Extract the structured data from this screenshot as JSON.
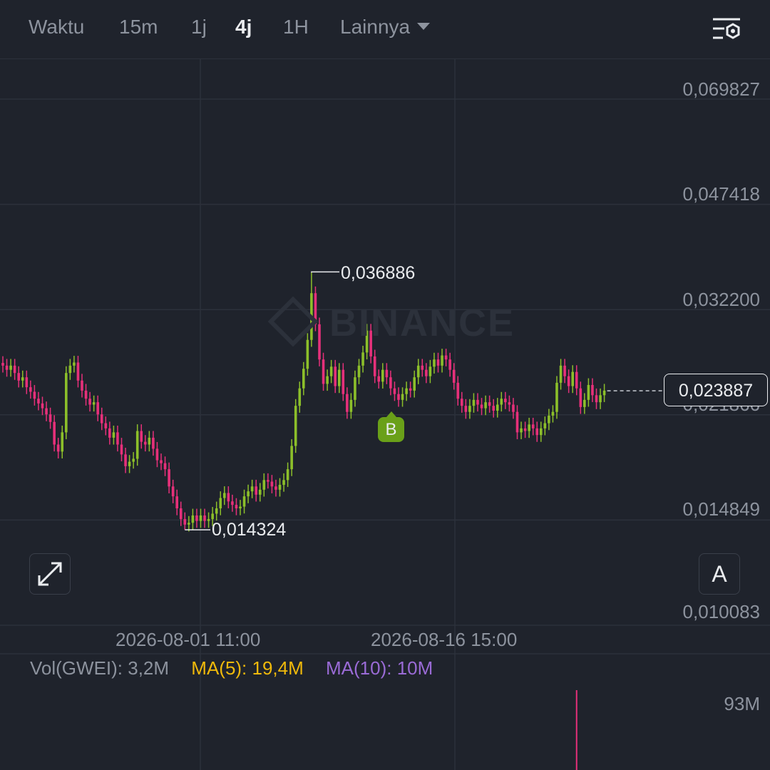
{
  "toolbar": {
    "time_label": "Waktu",
    "intervals": [
      "15m",
      "1j",
      "4j",
      "1H"
    ],
    "active_interval": "4j",
    "more_label": "Lainnya"
  },
  "colors": {
    "background": "#1f232c",
    "up": "#8cbf2a",
    "down": "#e6307a",
    "ma5": "#f0b90b",
    "ma10": "#9a6bd6",
    "grid": "#2c313b"
  },
  "watermark": "BINANCE",
  "last_price": "0,023887",
  "signal_marker": "B",
  "auto_button": "A",
  "chart_data": {
    "type": "candlestick",
    "price_axis_labels": [
      "0,069827",
      "0,047418",
      "0,032200",
      "0,021866",
      "0,014849",
      "0,010083"
    ],
    "price_axis_values": [
      0.069827,
      0.047418,
      0.0322,
      0.021866,
      0.014849,
      0.010083
    ],
    "y_scale": "log",
    "x_tick_labels": [
      "2026-08-01 11:00",
      "2026-08-16 15:00"
    ],
    "high": {
      "label": "0,036886",
      "value": 0.036886
    },
    "low": {
      "label": "0,014324",
      "value": 0.014324
    },
    "last": 0.023887,
    "grid": true,
    "close_series": [
      0.0262,
      0.0258,
      0.0262,
      0.0255,
      0.0248,
      0.0251,
      0.0242,
      0.0238,
      0.0232,
      0.0228,
      0.0224,
      0.0219,
      0.0213,
      0.0196,
      0.0191,
      0.0205,
      0.0255,
      0.0262,
      0.0265,
      0.0248,
      0.0239,
      0.0232,
      0.0227,
      0.0229,
      0.0219,
      0.0212,
      0.0208,
      0.0201,
      0.0205,
      0.0196,
      0.0189,
      0.0181,
      0.0184,
      0.0186,
      0.0206,
      0.0198,
      0.0196,
      0.0201,
      0.0193,
      0.0185,
      0.0183,
      0.0179,
      0.0168,
      0.0162,
      0.0155,
      0.0149,
      0.0146,
      0.0147,
      0.0151,
      0.0148,
      0.0151,
      0.0148,
      0.0149,
      0.0152,
      0.0155,
      0.0161,
      0.0164,
      0.0159,
      0.0157,
      0.0155,
      0.0156,
      0.0162,
      0.0165,
      0.0168,
      0.0163,
      0.0166,
      0.0172,
      0.0171,
      0.0168,
      0.0166,
      0.0169,
      0.0172,
      0.0179,
      0.0195,
      0.0226,
      0.0241,
      0.0259,
      0.0288,
      0.0342,
      0.0305,
      0.0268,
      0.0245,
      0.0252,
      0.0261,
      0.0243,
      0.0258,
      0.0236,
      0.0221,
      0.0231,
      0.0251,
      0.0262,
      0.0275,
      0.0298,
      0.0271,
      0.0252,
      0.0247,
      0.0258,
      0.0251,
      0.0241,
      0.0236,
      0.0231,
      0.0236,
      0.0241,
      0.0239,
      0.0251,
      0.0262,
      0.0258,
      0.0252,
      0.0261,
      0.0268,
      0.0262,
      0.0272,
      0.0268,
      0.0258,
      0.0246,
      0.0232,
      0.0226,
      0.0221,
      0.0226,
      0.0231,
      0.0227,
      0.0224,
      0.0229,
      0.0226,
      0.0222,
      0.0227,
      0.0232,
      0.0229,
      0.0227,
      0.0221,
      0.0205,
      0.0208,
      0.0206,
      0.0211,
      0.0208,
      0.0203,
      0.0208,
      0.0212,
      0.0218,
      0.0221,
      0.0246,
      0.0262,
      0.0252,
      0.0243,
      0.0256,
      0.0241,
      0.0225,
      0.0231,
      0.0244,
      0.0235,
      0.0229,
      0.0235,
      0.0239
    ],
    "volume_axis_label": "93M",
    "volume_spike_index": 145
  },
  "volume": {
    "vol": "Vol(GWEI): 3,2M",
    "ma5": "MA(5): 19,4M",
    "ma10": "MA(10): 10M"
  }
}
